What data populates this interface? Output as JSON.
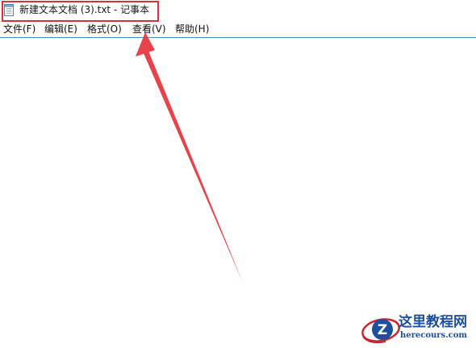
{
  "window": {
    "title": "新建文本文档 (3).txt - 记事本",
    "app_icon": "notepad-icon"
  },
  "menubar": {
    "items": [
      {
        "label": "文件(F)"
      },
      {
        "label": "编辑(E)"
      },
      {
        "label": "格式(O)"
      },
      {
        "label": "查看(V)"
      },
      {
        "label": "帮助(H)"
      }
    ]
  },
  "editor": {
    "content": ""
  },
  "annotation": {
    "highlight_color": "#d8313a",
    "arrow_color": "#e8434b"
  },
  "watermark": {
    "logo_letter": "Z",
    "title": "这里教程网",
    "url": "herecours.com"
  }
}
